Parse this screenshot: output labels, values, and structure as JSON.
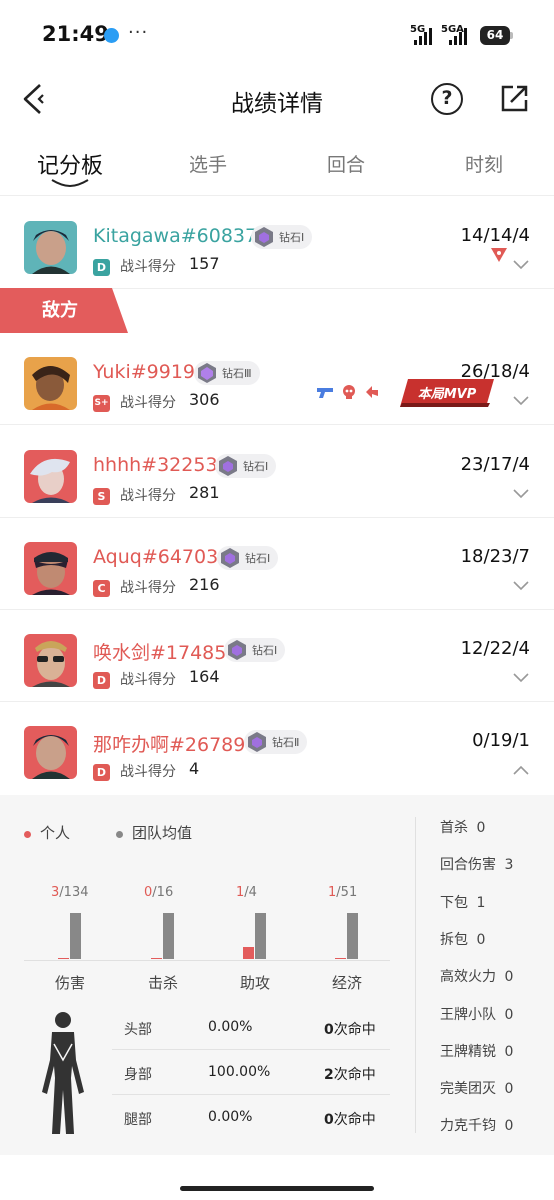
{
  "status_bar": {
    "time": "21:49",
    "more": "···",
    "signal_1": "5G",
    "signal_2": "5GA",
    "battery": "64"
  },
  "header": {
    "title": "战绩详情",
    "help_icon": "help-circle-icon",
    "share_icon": "share-icon"
  },
  "tabs": [
    {
      "label": "记分板",
      "active": true
    },
    {
      "label": "选手",
      "active": false
    },
    {
      "label": "回合",
      "active": false
    },
    {
      "label": "时刻",
      "active": false
    }
  ],
  "enemy_label": "敌方",
  "score_label": "战斗得分",
  "players": [
    {
      "name": "Kitagawa#60837",
      "rank": "钻石Ⅰ",
      "grade": "D",
      "grade_color": "#3aa3a0",
      "score": "157",
      "kda": "14/14/4",
      "self": true
    },
    {
      "name": "Yuki#9919",
      "rank": "钻石Ⅲ",
      "grade": "S+",
      "grade_color": "#e05a55",
      "score": "306",
      "kda": "26/18/4",
      "mvp": "本局MVP"
    },
    {
      "name": "hhhh#32253",
      "rank": "钻石Ⅰ",
      "grade": "S",
      "grade_color": "#e05a55",
      "score": "281",
      "kda": "23/17/4"
    },
    {
      "name": "Aquq#64703",
      "rank": "钻石Ⅰ",
      "grade": "C",
      "grade_color": "#e05a55",
      "score": "216",
      "kda": "18/23/7"
    },
    {
      "name": "唤水剑#17485",
      "rank": "钻石Ⅰ",
      "grade": "D",
      "grade_color": "#e05a55",
      "score": "164",
      "kda": "12/22/4"
    },
    {
      "name": "那咋办啊#26789",
      "rank": "钻石Ⅱ",
      "grade": "D",
      "grade_color": "#e05a55",
      "score": "4",
      "kda": "0/19/1"
    }
  ],
  "detail": {
    "legend_personal": "个人",
    "legend_team": "团队均值",
    "personal_color": "#e35c5c",
    "team_color": "#888888",
    "bars": [
      {
        "label": "伤害",
        "personal": "3",
        "team": "134",
        "personal_frac": 0.022,
        "team_frac": 1.0
      },
      {
        "label": "击杀",
        "personal": "0",
        "team": "16",
        "personal_frac": 0.0,
        "team_frac": 1.0
      },
      {
        "label": "助攻",
        "personal": "1",
        "team": "4",
        "personal_frac": 0.25,
        "team_frac": 1.0
      },
      {
        "label": "经济",
        "personal": "1",
        "team": "51",
        "personal_frac": 0.02,
        "team_frac": 1.0
      }
    ],
    "hits": [
      {
        "part": "头部",
        "pct": "0.00%",
        "count": "0",
        "unit": "次命中"
      },
      {
        "part": "身部",
        "pct": "100.00%",
        "count": "2",
        "unit": "次命中"
      },
      {
        "part": "腿部",
        "pct": "0.00%",
        "count": "0",
        "unit": "次命中"
      }
    ],
    "stats": [
      {
        "label": "首杀",
        "value": "0"
      },
      {
        "label": "回合伤害",
        "value": "3"
      },
      {
        "label": "下包",
        "value": "1"
      },
      {
        "label": "拆包",
        "value": "0"
      },
      {
        "label": "高效火力",
        "value": "0"
      },
      {
        "label": "王牌小队",
        "value": "0"
      },
      {
        "label": "王牌精锐",
        "value": "0"
      },
      {
        "label": "完美团灭",
        "value": "0"
      },
      {
        "label": "力克千钧",
        "value": "0"
      }
    ]
  }
}
